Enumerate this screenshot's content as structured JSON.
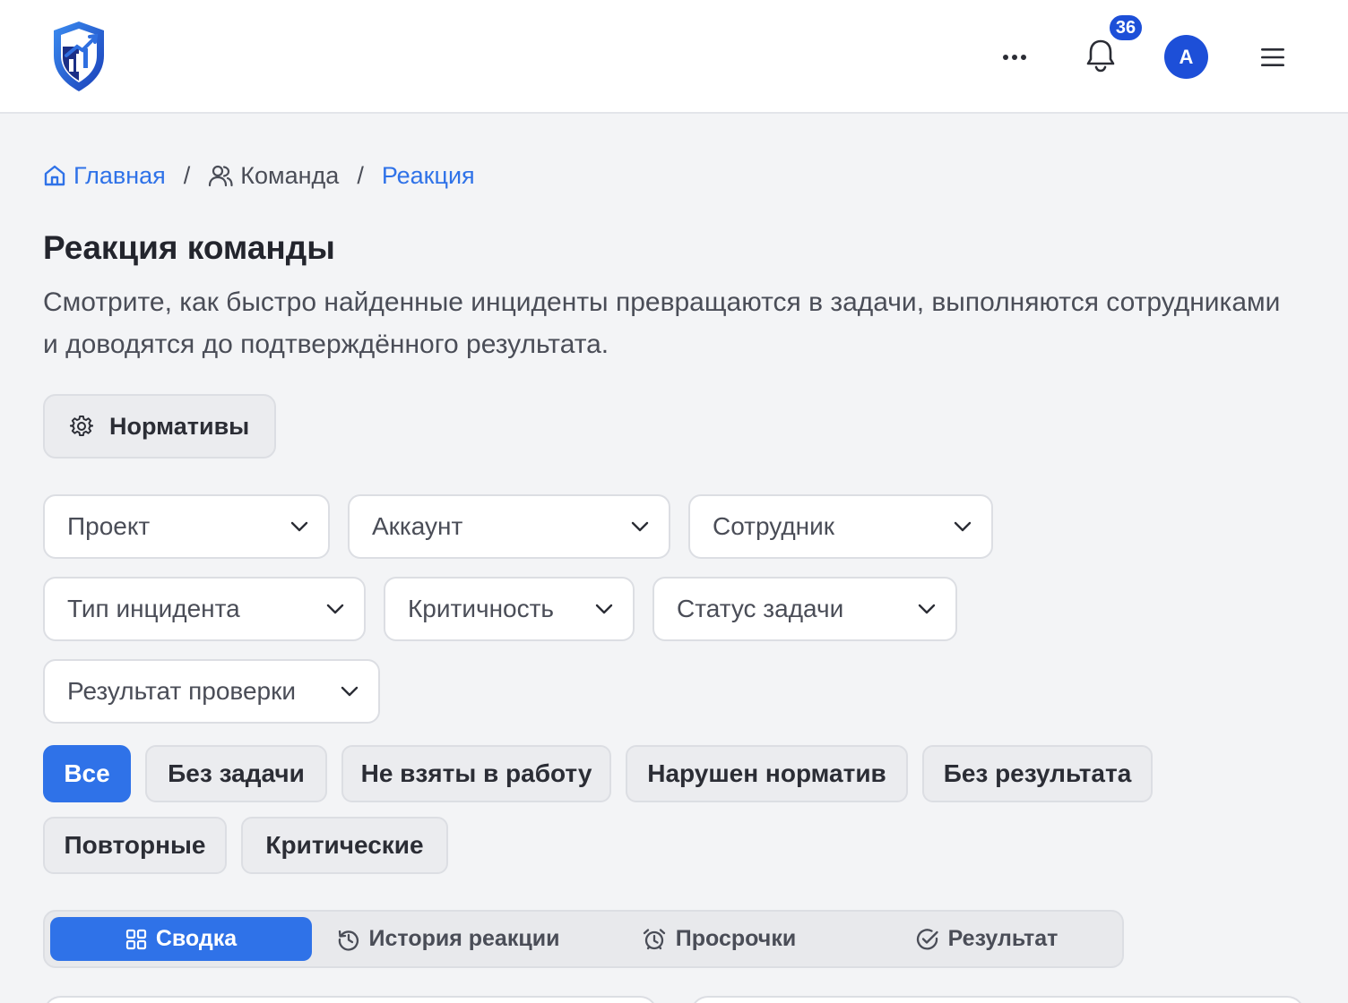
{
  "header": {
    "notifications_count": "36",
    "avatar_letter": "A",
    "colors": {
      "accent": "#2f72e8",
      "badge": "#1d4fd8",
      "text": "#2b2d35"
    }
  },
  "breadcrumb": {
    "home": "Главная",
    "team": "Команда",
    "current": "Реакция",
    "separator": "/"
  },
  "page": {
    "title": "Реакция команды",
    "description": "Смотрите, как быстро найденные инциденты превращаются в задачи, выполняются сотрудниками и доводятся до подтверждённого результата."
  },
  "norms_button": {
    "label": "Нормативы",
    "icon": "gear-icon"
  },
  "filters": {
    "project": "Проект",
    "account": "Аккаунт",
    "employee": "Сотрудник",
    "incident_type": "Тип инцидента",
    "criticality": "Критичность",
    "task_status": "Статус задачи",
    "check_result": "Результат проверки"
  },
  "chips": {
    "all": "Все",
    "no_task": "Без задачи",
    "not_taken": "Не взяты в работу",
    "norm_violated": "Нарушен норматив",
    "no_result": "Без результата",
    "repeated": "Повторные",
    "critical": "Критические"
  },
  "tabs": {
    "summary": "Сводка",
    "history": "История реакции",
    "overdue": "Просрочки",
    "result": "Результат"
  }
}
